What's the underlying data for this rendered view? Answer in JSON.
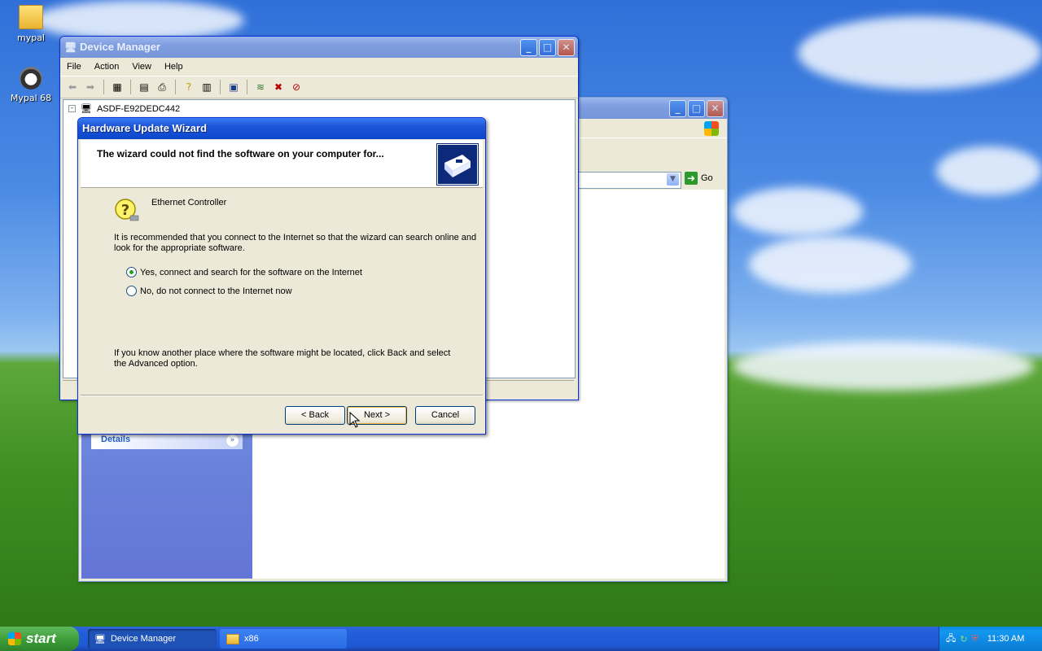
{
  "desktop": {
    "icons": [
      {
        "label": "mypal",
        "icon": "folder-icon"
      },
      {
        "label": "Mypal 68",
        "icon": "mypal-icon"
      }
    ]
  },
  "back_window": {
    "title": "x86",
    "go_label": "Go",
    "panel_title": "Details"
  },
  "device_manager": {
    "title": "Device Manager",
    "menu": [
      "File",
      "Action",
      "View",
      "Help"
    ],
    "tree_root": "ASDF-E92DEDC442"
  },
  "wizard": {
    "title": "Hardware Update Wizard",
    "heading": "The wizard could not find the software on your computer for...",
    "device_name": "Ethernet Controller",
    "recommend_text_1": "It is recommended that you connect to the Internet so that the wizard can search online and",
    "recommend_text_2": "look for the appropriate software.",
    "option_yes": "Yes, connect and search for the software on the Internet",
    "option_no": "No, do not connect to the Internet now",
    "selected_option": "yes",
    "hint_text_1": "If you know another place where the software might be located, click Back and select",
    "hint_text_2": "the Advanced option.",
    "back_button": "< Back",
    "next_button": "Next >",
    "cancel_button": "Cancel"
  },
  "taskbar": {
    "start_label": "start",
    "tasks": [
      {
        "label": "Device Manager",
        "active": true
      },
      {
        "label": "x86",
        "active": false
      }
    ],
    "clock": "11:30 AM"
  },
  "colors": {
    "title_active": "#0c47cc",
    "window_face": "#ece9d8",
    "taskbar": "#245edb",
    "start_green": "#3a9a37"
  }
}
